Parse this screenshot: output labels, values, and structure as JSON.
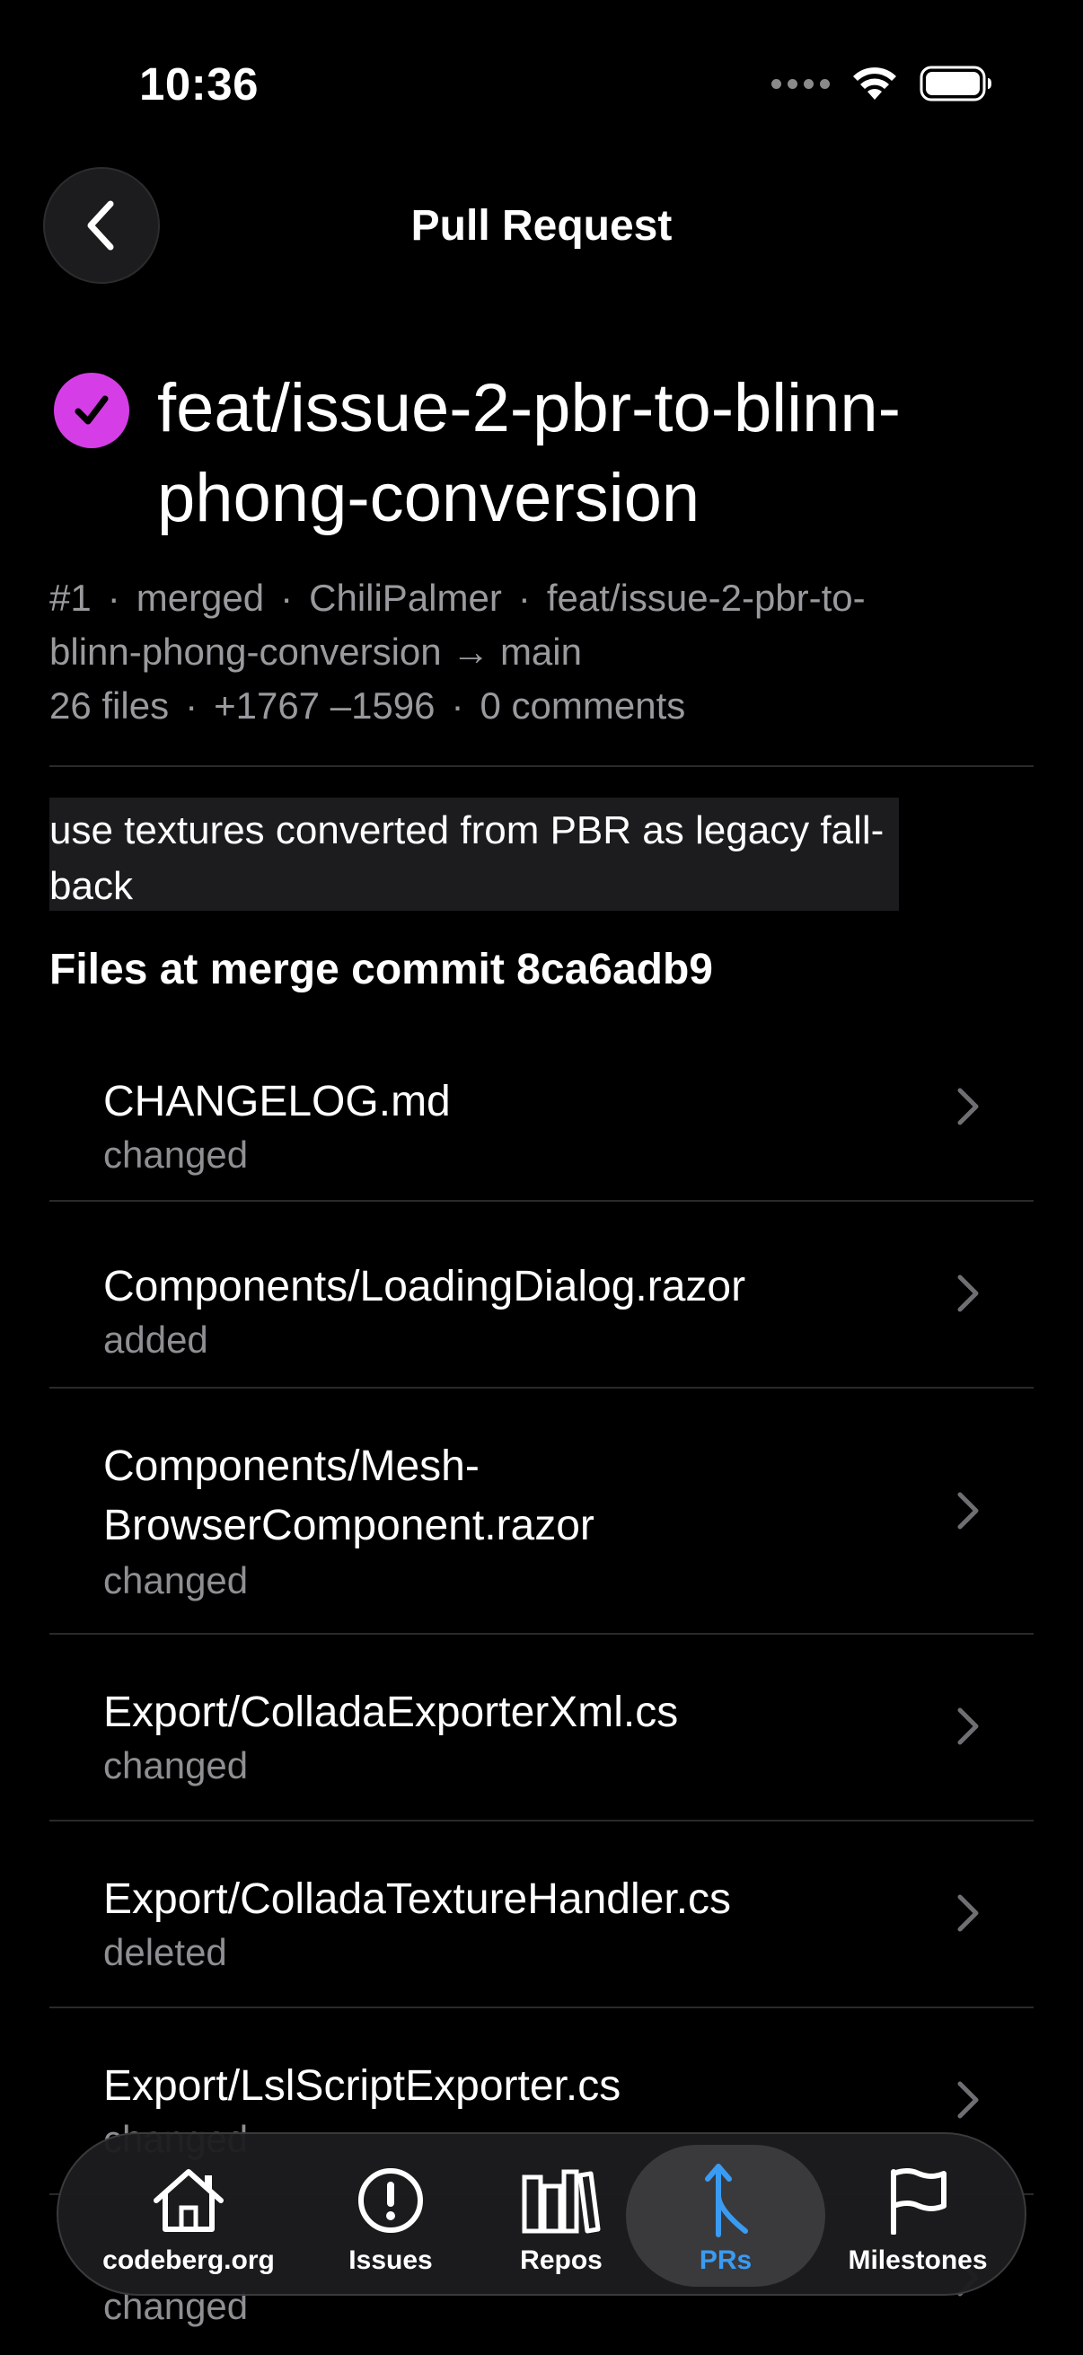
{
  "status_bar": {
    "time": "10:36"
  },
  "nav": {
    "title": "Pull Request"
  },
  "pr": {
    "title": "feat/issue-2-pbr-to-blinn-phong-conversion",
    "number": "#1",
    "state": "merged",
    "author": "ChiliPalmer",
    "branch_line1": "feat/issue-2-pbr-to-",
    "branch_line2": "blinn-phong-conversion → main",
    "files_count": "26 files",
    "diff": "+1767 –1596",
    "comments": "0 comments",
    "description": "use textures converted from PBR as legacy fall-back",
    "merge_color": "#d53ee6"
  },
  "files_heading": "Files at merge commit 8ca6adb9",
  "files": [
    {
      "name": "CHANGELOG.md",
      "status": "changed"
    },
    {
      "name": "Components/LoadingDialog.razor",
      "status": "added"
    },
    {
      "name": "Components/Mesh-BrowserComponent.razor",
      "name_line1": "Components/Mesh-",
      "name_line2": "BrowserComponent.razor",
      "status": "changed"
    },
    {
      "name": "Export/ColladaExporterXml.cs",
      "status": "changed"
    },
    {
      "name": "Export/ColladaTextureHandler.cs",
      "status": "deleted"
    },
    {
      "name": "Export/LslScriptExporter.cs",
      "status": "changed"
    },
    {
      "name": "",
      "status": "changed"
    }
  ],
  "tab_bar": {
    "active_color": "#3a9bf2",
    "tabs": [
      {
        "label": "codeberg.org",
        "icon": "home-icon"
      },
      {
        "label": "Issues",
        "icon": "exclamation-circle-icon"
      },
      {
        "label": "Repos",
        "icon": "books-icon"
      },
      {
        "label": "PRs",
        "icon": "merge-arrow-icon",
        "active": true
      },
      {
        "label": "Milestones",
        "icon": "flag-icon"
      }
    ]
  }
}
